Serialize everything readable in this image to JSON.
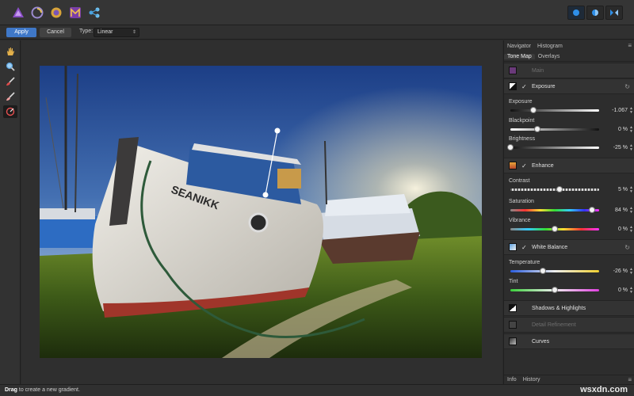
{
  "context_toolbar": {
    "apply_label": "Apply",
    "cancel_label": "Cancel",
    "type_label": "Type:",
    "type_value": "Linear"
  },
  "personas": [
    "photo-persona-icon",
    "liquify-persona-icon",
    "develop-persona-icon",
    "tone-mapping-persona-icon",
    "export-persona-icon"
  ],
  "tools": [
    "hand-tool-icon",
    "zoom-tool-icon",
    "paint-brush-icon",
    "erase-brush-icon",
    "gradient-tool-icon"
  ],
  "panel": {
    "top_tabs": [
      "Navigator",
      "Histogram"
    ],
    "sub_tabs": [
      "Tone Map",
      "Overlays"
    ],
    "main_label": "Main",
    "sections": {
      "exposure": {
        "title": "Exposure",
        "sliders": [
          {
            "label": "Exposure",
            "value": "-1.067",
            "fraction": 0.26
          },
          {
            "label": "Blackpoint",
            "value": "0 %",
            "fraction": 0.3
          },
          {
            "label": "Brightness",
            "value": "-25 %",
            "fraction": 0.0
          }
        ]
      },
      "enhance": {
        "title": "Enhance",
        "sliders": [
          {
            "label": "Contrast",
            "value": "5 %",
            "fraction": 0.55
          },
          {
            "label": "Saturation",
            "value": "84 %",
            "fraction": 0.92
          },
          {
            "label": "Vibrance",
            "value": "0 %",
            "fraction": 0.5
          }
        ]
      },
      "white_balance": {
        "title": "White Balance",
        "sliders": [
          {
            "label": "Temperature",
            "value": "-26 %",
            "fraction": 0.37
          },
          {
            "label": "Tint",
            "value": "0 %",
            "fraction": 0.5
          }
        ]
      },
      "shadows_highlights": {
        "title": "Shadows & Highlights"
      },
      "detail_refinement": {
        "title": "Detail Refinement"
      },
      "curves": {
        "title": "Curves"
      }
    },
    "bottom_tabs": [
      "Info",
      "History"
    ]
  },
  "status": {
    "bold": "Drag",
    "message": " to create a new gradient."
  },
  "watermark": "wsxdn.com",
  "colors": {
    "accent": "#3f78c8",
    "panel_bg": "#2d2d2d",
    "toolbar_bg": "#353535"
  }
}
